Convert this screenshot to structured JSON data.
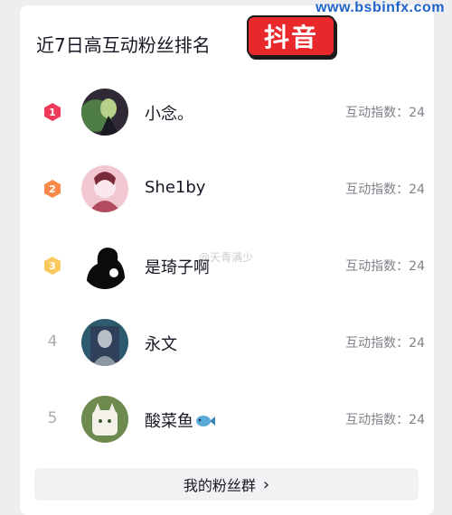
{
  "watermark": "www.bsbinfx.com",
  "header": {
    "title": "近7日高互动粉丝排名",
    "logo_text": "抖音"
  },
  "fans": [
    {
      "rank": "1",
      "name": "小念。",
      "score_label": "互动指数：24",
      "badge_color": "#ee3a5a",
      "avatar_colors": [
        "#2f2a36",
        "#4f7d46",
        "#b7d089"
      ]
    },
    {
      "rank": "2",
      "name": "She1by",
      "score_label": "互动指数：24",
      "badge_color": "#fb8a4a",
      "avatar_colors": [
        "#f2c7d2",
        "#b24b5d",
        "#fbe8ef"
      ]
    },
    {
      "rank": "3",
      "name": "是琦子啊",
      "score_label": "互动指数：24",
      "badge_color": "#fcc95e",
      "avatar_colors": [
        "#0b0b0b",
        "#ffffff",
        "#0b0b0b"
      ]
    },
    {
      "rank": "4",
      "name": "永文",
      "score_label": "互动指数：24",
      "badge_color": "",
      "avatar_colors": [
        "#2d5a6c",
        "#b8c0c7",
        "#31405a"
      ]
    },
    {
      "rank": "5",
      "name": "酸菜鱼",
      "score_label": "互动指数：24",
      "badge_color": "",
      "avatar_colors": [
        "#6e8a4f",
        "#f4f1ea",
        "#3f5a34"
      ]
    }
  ],
  "faint_watermark": "@天青满少",
  "footer": {
    "group_button": "我的粉丝群",
    "chevron": "›"
  }
}
